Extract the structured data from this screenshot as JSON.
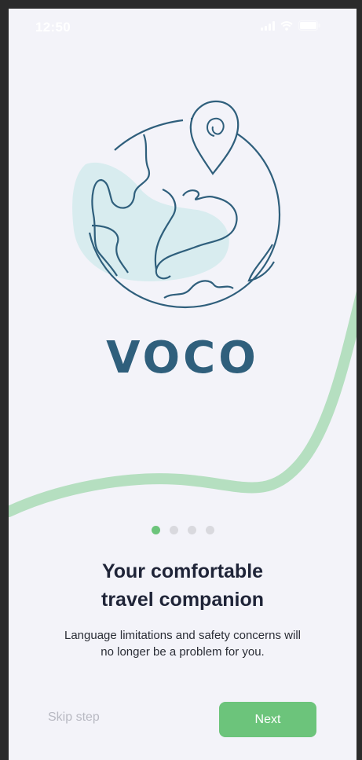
{
  "status_bar": {
    "time": "12:50",
    "icons": [
      "signal-icon",
      "wifi-icon",
      "battery-icon"
    ]
  },
  "brand": {
    "logo_text": "VOCO",
    "logo_color": "#2f5f7c",
    "illustration": "globe-with-location-pin"
  },
  "pager": {
    "total": 4,
    "active_index": 0
  },
  "onboarding": {
    "title_line1": "Your comfortable",
    "title_line2": "travel companion",
    "description_line1": "Language limitations and safety concerns will",
    "description_line2": "no longer be a problem for you."
  },
  "actions": {
    "skip_label": "Skip step",
    "next_label": "Next"
  },
  "colors": {
    "background": "#f3f3f9",
    "accent_green": "#6cc47b",
    "wave_green": "#b5dfc0",
    "globe_stroke": "#2f5f7c",
    "globe_fill": "#d8ecef"
  }
}
